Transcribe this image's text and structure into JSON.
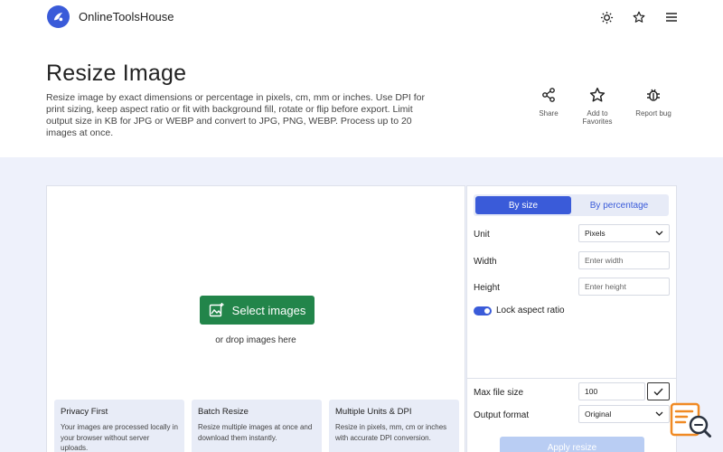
{
  "header": {
    "brand": "OnlineToolsHouse",
    "icons": [
      "sun-icon",
      "star-icon",
      "menu-icon"
    ]
  },
  "hero": {
    "title": "Resize Image",
    "description": "Resize image by exact dimensions or percentage in pixels, cm, mm or inches. Use DPI for print sizing, keep aspect ratio or fit with background fill, rotate or flip before export. Limit output size in KB for JPG or WEBP and convert to JPG, PNG, WEBP. Process up to 20 images at once.",
    "actions": [
      {
        "label": "Share",
        "icon": "share-icon"
      },
      {
        "label": "Add to Favorites",
        "icon": "star-icon"
      },
      {
        "label": "Report bug",
        "icon": "bug-icon"
      }
    ]
  },
  "dropzone": {
    "button_label": "Select images",
    "hint": "or drop images here"
  },
  "features": [
    {
      "title": "Privacy First",
      "desc": "Your images are processed locally in your browser without server uploads."
    },
    {
      "title": "Batch Resize",
      "desc": "Resize multiple images at once and download them instantly."
    },
    {
      "title": "Multiple Units & DPI",
      "desc": "Resize in pixels, mm, cm or inches with accurate DPI conversion."
    }
  ],
  "settings": {
    "mode_tabs": [
      "By size",
      "By percentage"
    ],
    "active_mode": "By size",
    "unit_label": "Unit",
    "unit_value": "Pixels",
    "width_label": "Width",
    "width_placeholder": "Enter width",
    "height_label": "Height",
    "height_placeholder": "Enter height",
    "lock_label": "Lock aspect ratio",
    "lock_enabled": true,
    "max_size_label": "Max file size",
    "max_size_value": "100",
    "output_label": "Output format",
    "output_value": "Original",
    "apply_label": "Apply resize"
  },
  "colors": {
    "accent": "#3a5bd9",
    "primary_green": "#22854a",
    "workspace_bg": "#eef1fb",
    "widget_orange": "#f08a24"
  }
}
